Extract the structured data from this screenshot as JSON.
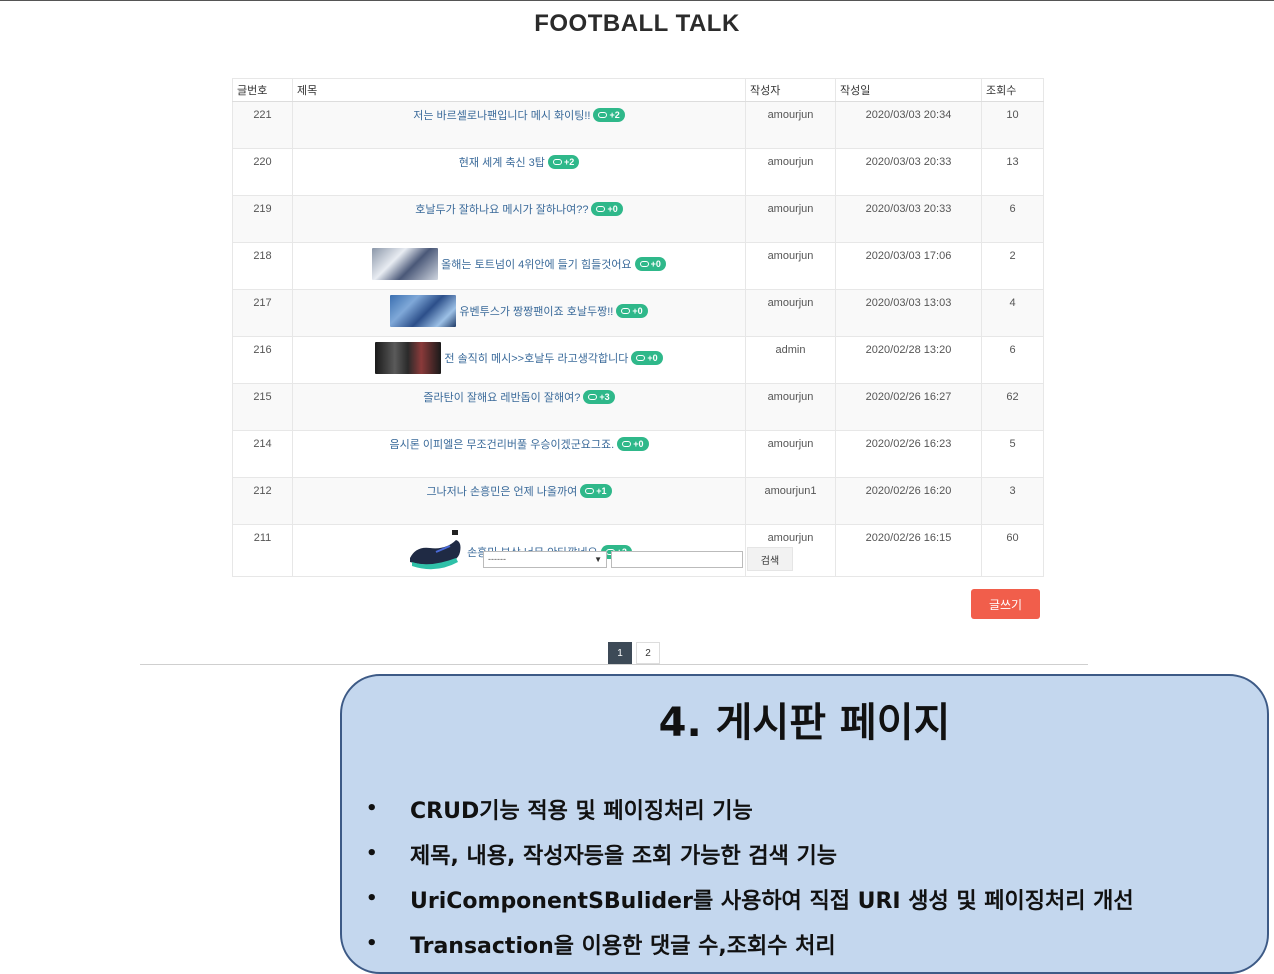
{
  "header": {
    "title": "FOOTBALL TALK"
  },
  "board": {
    "columns": [
      "글번호",
      "제목",
      "작성자",
      "작성일",
      "조회수"
    ],
    "rows": [
      {
        "no": "221",
        "title": "저는 바르셀로나팬입니다 메시 화이팅!!",
        "comments": "+2",
        "writer": "amourjun",
        "date": "2020/03/03 20:34",
        "views": "10",
        "thumb": ""
      },
      {
        "no": "220",
        "title": "현재 세계 축신 3탑",
        "comments": "+2",
        "writer": "amourjun",
        "date": "2020/03/03 20:33",
        "views": "13",
        "thumb": ""
      },
      {
        "no": "219",
        "title": "호날두가 잘하나요 메시가 잘하나여??",
        "comments": "+0",
        "writer": "amourjun",
        "date": "2020/03/03 20:33",
        "views": "6",
        "thumb": ""
      },
      {
        "no": "218",
        "title": "올해는 토트넘이 4위안에 들기 힘들것어요",
        "comments": "+0",
        "writer": "amourjun",
        "date": "2020/03/03 17:06",
        "views": "2",
        "thumb": "t1"
      },
      {
        "no": "217",
        "title": "유벤투스가 짱짱팬이죠 호날두짱!!",
        "comments": "+0",
        "writer": "amourjun",
        "date": "2020/03/03 13:03",
        "views": "4",
        "thumb": "t2"
      },
      {
        "no": "216",
        "title": "전 솔직히 메시>>호날두 라고생각합니다",
        "comments": "+0",
        "writer": "admin",
        "date": "2020/02/28 13:20",
        "views": "6",
        "thumb": "t3"
      },
      {
        "no": "215",
        "title": "즐라탄이 잘해요 레반돕이 잘해여?",
        "comments": "+3",
        "writer": "amourjun",
        "date": "2020/02/26 16:27",
        "views": "62",
        "thumb": ""
      },
      {
        "no": "214",
        "title": "음시론 이피엘은 무조건리버풀 우승이겠군요그죠.",
        "comments": "+0",
        "writer": "amourjun",
        "date": "2020/02/26 16:23",
        "views": "5",
        "thumb": ""
      },
      {
        "no": "212",
        "title": "그나저나 손흥민은 언제 나올까여",
        "comments": "+1",
        "writer": "amourjun1",
        "date": "2020/02/26 16:20",
        "views": "3",
        "thumb": ""
      },
      {
        "no": "211",
        "title": "손흥민 부상 너무 안타깝네요",
        "comments": "+2",
        "writer": "amourjun",
        "date": "2020/02/26 16:15",
        "views": "60",
        "thumb": "shoe"
      }
    ]
  },
  "search": {
    "select_value": "------",
    "input_value": "",
    "button_label": "검색"
  },
  "write_button": "글쓰기",
  "pagination": {
    "pages": [
      "1",
      "2"
    ],
    "current": "1"
  },
  "panel": {
    "title": "4. 게시판 페이지",
    "bullet": "•",
    "items": [
      "CRUD기능 적용 및 페이징처리 기능",
      "제목, 내용, 작성자등을 조회 가능한 검색 기능",
      "UriComponentSBulider를 사용하여 직접 URI 생성 및 페이징처리 개선",
      "Transaction을 이용한 댓글 수,조회수 처리"
    ]
  },
  "colors": {
    "accent_green": "#2fb88a",
    "write_button": "#f15e4b",
    "panel_bg": "#c4d7ee",
    "panel_border": "#3d5a86"
  }
}
